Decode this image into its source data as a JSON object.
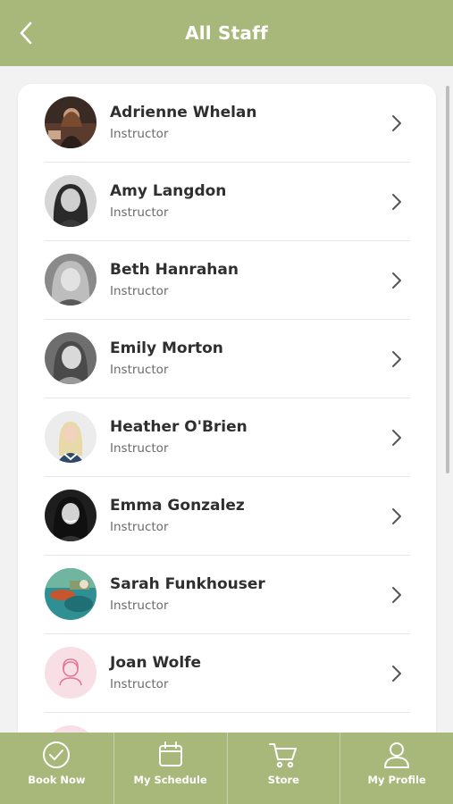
{
  "header": {
    "title": "All Staff",
    "back_icon": "chevron-left-icon"
  },
  "staff": [
    {
      "name": "Adrienne Whelan",
      "role": "Instructor"
    },
    {
      "name": "Amy Langdon",
      "role": "Instructor"
    },
    {
      "name": "Beth Hanrahan",
      "role": "Instructor"
    },
    {
      "name": "Emily Morton",
      "role": "Instructor"
    },
    {
      "name": "Heather O'Brien",
      "role": "Instructor"
    },
    {
      "name": "Emma Gonzalez",
      "role": "Instructor"
    },
    {
      "name": "Sarah Funkhouser",
      "role": "Instructor"
    },
    {
      "name": "Joan Wolfe",
      "role": "Instructor"
    }
  ],
  "tabs": [
    {
      "label": "Book Now",
      "icon": "check-circle-icon"
    },
    {
      "label": "My Schedule",
      "icon": "calendar-icon"
    },
    {
      "label": "Store",
      "icon": "cart-icon"
    },
    {
      "label": "My Profile",
      "icon": "user-icon"
    }
  ],
  "colors": {
    "brand": "#a8b87a",
    "text": "#2f2f2f",
    "subtext": "#6b6b6b",
    "placeholder_avatar": "#f8dfe6"
  }
}
